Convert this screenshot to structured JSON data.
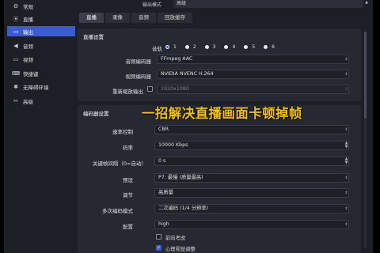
{
  "sidebar": {
    "items": [
      {
        "label": "常规",
        "icon": "gear-icon",
        "glyph": "⚙",
        "active": false
      },
      {
        "label": "直播",
        "icon": "broadcast-icon",
        "glyph": "⦿",
        "active": false
      },
      {
        "label": "输出",
        "icon": "output-icon",
        "glyph": "▭",
        "active": true
      },
      {
        "label": "音频",
        "icon": "speaker-icon",
        "glyph": "◀",
        "active": false
      },
      {
        "label": "视频",
        "icon": "monitor-icon",
        "glyph": "▭",
        "active": false
      },
      {
        "label": "快捷键",
        "icon": "keyboard-icon",
        "glyph": "⌨",
        "active": false
      },
      {
        "label": "无障碍环境",
        "icon": "accessibility-icon",
        "glyph": "✱",
        "active": false
      },
      {
        "label": "高级",
        "icon": "wrench-icon",
        "glyph": "✂",
        "active": false
      }
    ]
  },
  "topbar": {
    "output_mode_label": "输出模式",
    "output_mode_value": "高级"
  },
  "tabs": [
    {
      "label": "直播",
      "active": true
    },
    {
      "label": "录像",
      "active": false
    },
    {
      "label": "音频",
      "active": false
    },
    {
      "label": "回放缓存",
      "active": false
    }
  ],
  "live_settings": {
    "title": "直播设置",
    "audio_track_label": "音轨",
    "audio_tracks": [
      {
        "num": "1",
        "selected": true
      },
      {
        "num": "2",
        "selected": false
      },
      {
        "num": "3",
        "selected": false
      },
      {
        "num": "4",
        "selected": false
      },
      {
        "num": "5",
        "selected": false
      },
      {
        "num": "6",
        "selected": false
      }
    ],
    "audio_encoder_label": "音频编码器",
    "audio_encoder_value": "FFmpeg AAC",
    "video_encoder_label": "视频编码器",
    "video_encoder_value": "NVIDIA NVENC H.264",
    "rescale_label": "重新缩放输出",
    "rescale_value": "1920x1080"
  },
  "encoder_settings": {
    "title": "编码器设置",
    "rate_control_label": "速率控制",
    "rate_control_value": "CBR",
    "bitrate_label": "码率",
    "bitrate_value": "10000 Kbps",
    "keyframe_label": "关键帧间隔（0=自动）",
    "keyframe_value": "0 s",
    "preset_label": "预设",
    "preset_value": "P7: 最慢 (质量最高)",
    "tuning_label": "调节",
    "tuning_value": "高质量",
    "multipass_label": "多次编码模式",
    "multipass_value": "二次编码 (1/4 分辨率)",
    "profile_label": "配置",
    "profile_value": "high",
    "lookahead_label": "前向考虑",
    "psycho_label": "心理视觉调整"
  },
  "overlay_caption": "一招解决直播画面卡顿掉帧",
  "colors": {
    "accent": "#3b5bd6",
    "caption": "#f2c200",
    "panel": "#262932",
    "window": "#1d1f26"
  }
}
